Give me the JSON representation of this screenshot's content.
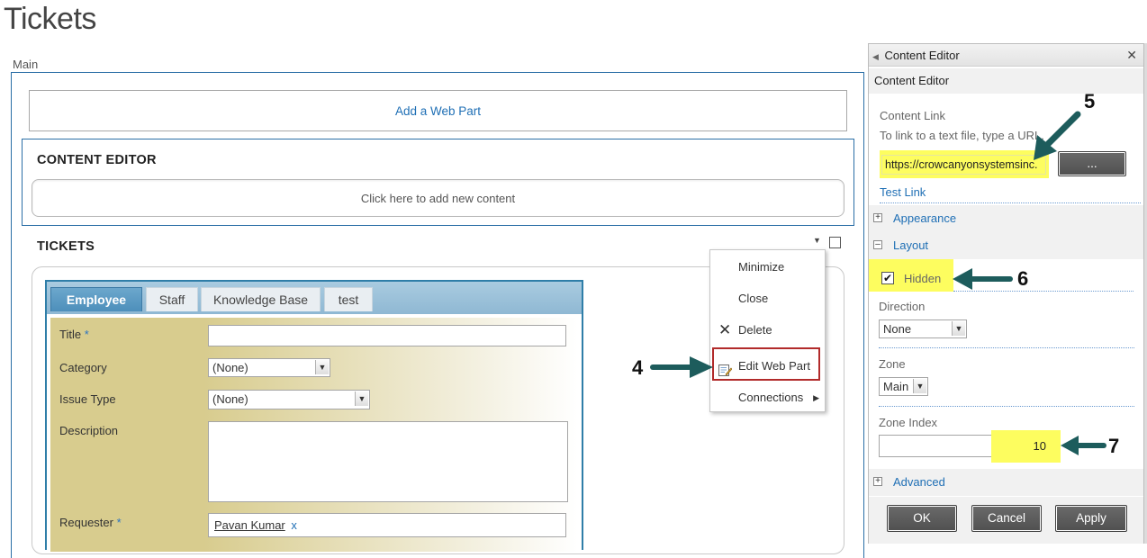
{
  "page": {
    "title": "Tickets",
    "zone_label": "Main"
  },
  "main": {
    "add_web_part": "Add a Web Part",
    "content_editor_title": "CONTENT EDITOR",
    "add_content": "Click here to add new content",
    "tickets_title": "TICKETS"
  },
  "form": {
    "tabs": [
      {
        "label": "Employee"
      },
      {
        "label": "Staff"
      },
      {
        "label": "Knowledge Base"
      },
      {
        "label": "test"
      }
    ],
    "fields": {
      "title_label": "Title",
      "category_label": "Category",
      "category_value": "(None)",
      "issue_type_label": "Issue Type",
      "issue_type_value": "(None)",
      "description_label": "Description",
      "requester_label": "Requester",
      "requester_value": "Pavan Kumar",
      "requester_remove": "x",
      "required_marker": "*"
    }
  },
  "context_menu": {
    "items": [
      {
        "label": "Minimize"
      },
      {
        "label": "Close"
      },
      {
        "label": "Delete"
      },
      {
        "label": "Edit Web Part"
      },
      {
        "label": "Connections"
      }
    ]
  },
  "callouts": {
    "c4": "4",
    "c5": "5",
    "c6": "6",
    "c7": "7"
  },
  "tool_pane": {
    "header": "Content Editor",
    "sub_header": "Content Editor",
    "content_link_label": "Content Link",
    "content_link_help": "To link to a text file, type a URL.",
    "content_link_value": "https://crowcanyonsystemsinc.",
    "browse_button": "...",
    "test_link": "Test Link",
    "sections": {
      "appearance": "Appearance",
      "layout": "Layout",
      "advanced": "Advanced"
    },
    "hidden_label": "Hidden",
    "hidden_checked": true,
    "direction_label": "Direction",
    "direction_value": "None",
    "zone_label": "Zone",
    "zone_value": "Main",
    "zone_index_label": "Zone Index",
    "zone_index_value": "10",
    "buttons": {
      "ok": "OK",
      "cancel": "Cancel",
      "apply": "Apply"
    }
  },
  "colors": {
    "accent": "#2a6ea6",
    "link": "#1f6fb5",
    "highlight": "#fdfd5f",
    "callout_arrow": "#1d5c5c",
    "menu_highlight": "#b22b2b"
  }
}
